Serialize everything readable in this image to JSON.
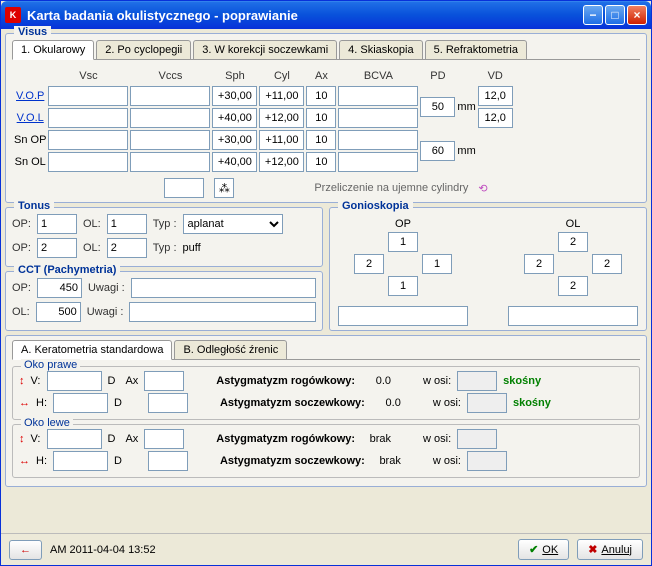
{
  "window": {
    "title": "Karta badania okulistycznego - poprawianie"
  },
  "visus": {
    "legend": "Visus",
    "tabs": [
      "1. Okularowy",
      "2. Po cyclopegii",
      "3. W korekcji soczewkami",
      "4. Skiaskopia",
      "5. Refraktometria"
    ],
    "headers": {
      "vsc": "Vsc",
      "vccs": "Vccs",
      "sph": "Sph",
      "cyl": "Cyl",
      "ax": "Ax",
      "bcva": "BCVA",
      "pd": "PD",
      "vd": "VD"
    },
    "rows": [
      {
        "label": "V.O.P",
        "sph": "+30,00",
        "cyl": "+11,00",
        "ax": "10",
        "vd": "12,0"
      },
      {
        "label": "V.O.L",
        "sph": "+40,00",
        "cyl": "+12,00",
        "ax": "10",
        "vd": "12,0"
      },
      {
        "label": "Sn OP",
        "sph": "+30,00",
        "cyl": "+11,00",
        "ax": "10"
      },
      {
        "label": "Sn OL",
        "sph": "+40,00",
        "cyl": "+12,00",
        "ax": "10"
      }
    ],
    "pd": [
      "50",
      "60"
    ],
    "mm": "mm",
    "conv": "Przeliczenie na ujemne cylindry"
  },
  "tonus": {
    "legend": "Tonus",
    "op_lbl": "OP:",
    "ol_lbl": "OL:",
    "typ_lbl": "Typ :",
    "r1": {
      "op": "1",
      "ol": "1",
      "typ": "aplanat"
    },
    "r2": {
      "op": "2",
      "ol": "2",
      "typ": "puff"
    }
  },
  "cct": {
    "legend": "CCT (Pachymetria)",
    "op_lbl": "OP:",
    "ol_lbl": "OL:",
    "uwagi_lbl": "Uwagi :",
    "op": "450",
    "ol": "500"
  },
  "gonio": {
    "legend": "Gonioskopia",
    "op_lbl": "OP",
    "ol_lbl": "OL",
    "op": {
      "top": "1",
      "left": "2",
      "right": "1",
      "bottom": "1"
    },
    "ol": {
      "top": "2",
      "left": "2",
      "right": "2",
      "bottom": "2"
    }
  },
  "kerato": {
    "tabs": [
      "A. Keratometria standardowa",
      "B. Odległość źrenic"
    ],
    "oko_prawe": "Oko prawe",
    "oko_lewe": "Oko lewe",
    "v": "V:",
    "h": "H:",
    "d": "D",
    "ax": "Ax",
    "ast_rog": "Astygmatyzm rogówkowy:",
    "ast_socz": "Astygmatyzm soczewkowy:",
    "w_osi": "w osi:",
    "skosny": "skośny",
    "brak": "brak",
    "zero": "0.0"
  },
  "footer": {
    "back": "←",
    "stamp": "AM 2011-04-04 13:52",
    "ok": "OK",
    "anuluj": "Anuluj"
  }
}
